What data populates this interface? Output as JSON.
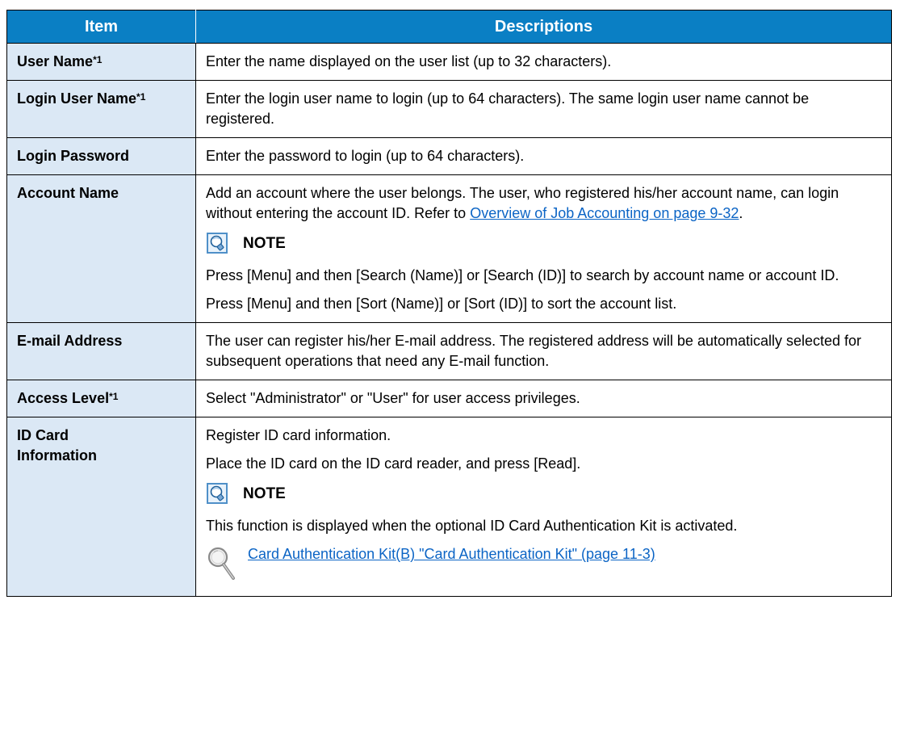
{
  "header": {
    "item": "Item",
    "descriptions": "Descriptions"
  },
  "rows": {
    "user_name": {
      "item": "User Name",
      "sup": "*1",
      "desc": "Enter the name displayed on the user list (up to 32 characters)."
    },
    "login_user_name": {
      "item": "Login User Name",
      "sup": "*1",
      "desc": "Enter the login user name to login (up to 64 characters). The same login user name cannot be registered."
    },
    "login_password": {
      "item": "Login Password",
      "desc": "Enter the password to login (up to 64 characters)."
    },
    "account_name": {
      "item": "Account Name",
      "desc_before": "Add an account where the user belongs. The user, who registered his/her account name, can login without entering the account ID. Refer to ",
      "link": "Overview of Job Accounting on page 9-32",
      "desc_after": ".",
      "note_title": "NOTE",
      "note_1": "Press [Menu] and then [Search (Name)] or [Search (ID)] to search by account name or account ID.",
      "note_2": "Press [Menu] and then [Sort (Name)] or [Sort (ID)] to sort the account list."
    },
    "email_address": {
      "item": "E-mail Address",
      "desc": "The user can register his/her E-mail address. The registered address will be automatically selected for subsequent operations that need any E-mail function."
    },
    "access_level": {
      "item": "Access Level",
      "sup": "*1",
      "desc": "Select \"Administrator\" or \"User\" for user access privileges."
    },
    "id_card_information": {
      "item": "ID Card Information",
      "desc_1": "Register ID card information.",
      "desc_2": "Place the ID card on the ID card reader, and press [Read].",
      "note_title": "NOTE",
      "note_1": "This function is displayed when the optional ID Card Authentication Kit is activated.",
      "ref_link": "Card Authentication Kit(B) \"Card Authentication Kit\" (page 11-3)"
    }
  },
  "colors": {
    "header_bg": "#0a7fc4",
    "item_bg": "#dbe8f5",
    "link": "#0b64c5"
  },
  "icons": {
    "note": "note-bulb-icon",
    "reference": "magnifier-icon"
  }
}
